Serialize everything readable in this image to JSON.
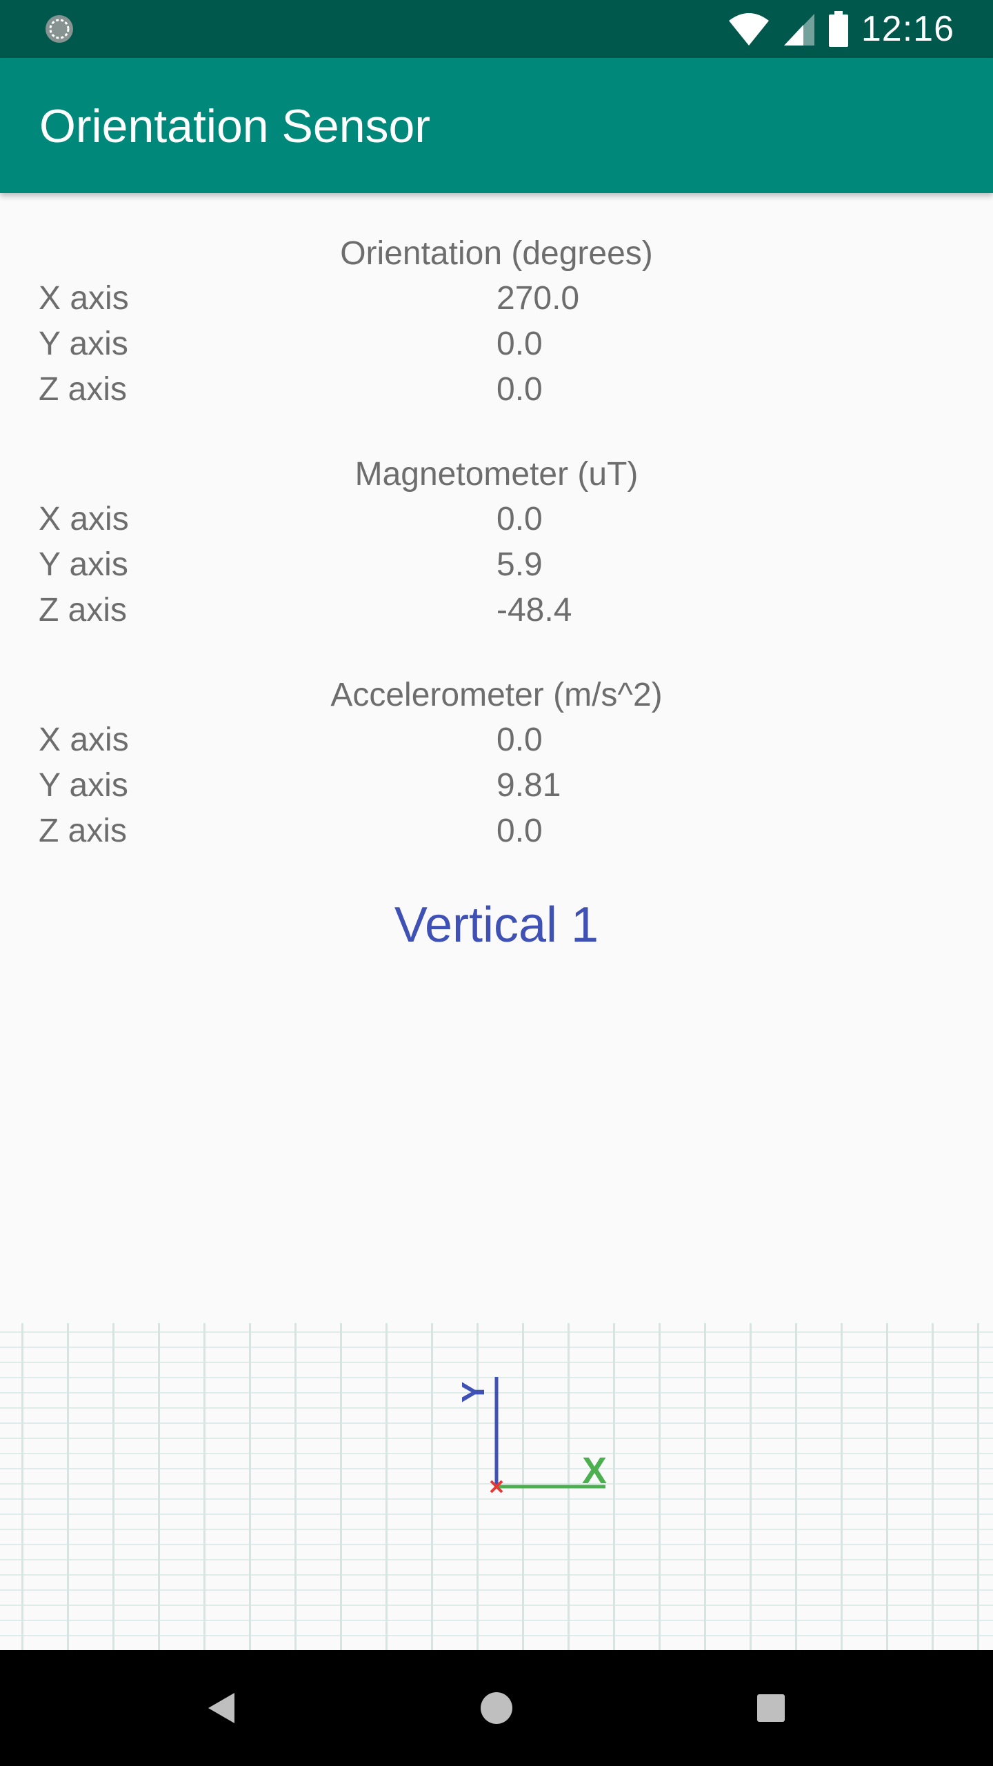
{
  "status_bar": {
    "time": "12:16",
    "icons": [
      "sync-icon",
      "wifi-icon",
      "signal-icon",
      "battery-icon"
    ]
  },
  "app_bar": {
    "title": "Orientation Sensor"
  },
  "sections": [
    {
      "title": "Orientation (degrees)",
      "rows": [
        {
          "label": "X axis",
          "value": "270.0"
        },
        {
          "label": "Y axis",
          "value": "0.0"
        },
        {
          "label": "Z axis",
          "value": "0.0"
        }
      ]
    },
    {
      "title": "Magnetometer (uT)",
      "rows": [
        {
          "label": "X axis",
          "value": "0.0"
        },
        {
          "label": "Y axis",
          "value": "5.9"
        },
        {
          "label": "Z axis",
          "value": "-48.4"
        }
      ]
    },
    {
      "title": "Accelerometer (m/s^2)",
      "rows": [
        {
          "label": "X axis",
          "value": "0.0"
        },
        {
          "label": "Y axis",
          "value": "9.81"
        },
        {
          "label": "Z axis",
          "value": "0.0"
        }
      ]
    }
  ],
  "status_text": "Vertical 1",
  "axes_indicator": {
    "x_label": "X",
    "y_label": "Y",
    "x_color": "#4caf50",
    "y_color": "#3f51b5",
    "z_color": "#e53935"
  },
  "colors": {
    "status_bar": "#00574b",
    "app_bar": "#00897b",
    "accent_text": "#3f51b5"
  },
  "nav_bar": {
    "buttons": [
      "back-icon",
      "home-icon",
      "recents-icon"
    ]
  }
}
